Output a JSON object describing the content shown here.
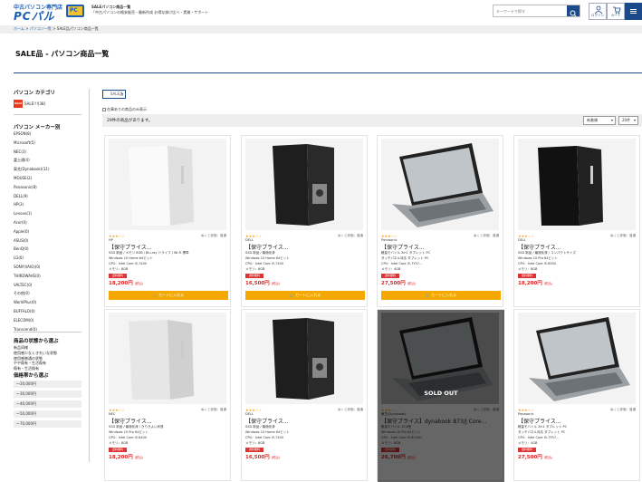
{
  "header": {
    "logo_small": "中古パソコン専門店",
    "logo_big": "PCパル",
    "logo_screen": "PC",
    "tagline1": "SALEパソコン商品一覧",
    "tagline2": "「中古パソコンの格安販売・最新作成 お得な掛け比べ・賃貸・サポート",
    "search_placeholder": "キーワードで探す",
    "login_label": "ログイン",
    "cart_label": "カート",
    "accent": "#1a4a8a"
  },
  "breadcrumb": {
    "home": "ホーム",
    "sep1": " > ",
    "list": "パソコン一覧",
    "sep2": " > ",
    "current": "SALE品パソコン商品一覧"
  },
  "page_title": "SALE品 - パソコン商品一覧",
  "sidebar": {
    "category_title": "パソコン カテゴリ",
    "category_item": "SALE!!!(38)",
    "sale_tag": "SALE",
    "maker_title": "パソコン メーカー別",
    "makers": [
      "EPSON(8)",
      "Microsoft(5)",
      "NEC(3)",
      "富士通(4)",
      "東芝(Dynabook)(11)",
      "MOUSE(2)",
      "Panasonic(8)",
      "DELL(9)",
      "HP(3)",
      "Lenovo(1)",
      "Acer(0)",
      "Apple(0)",
      "ASUS(0)",
      "BenQ(0)",
      "LG(0)",
      "SONY(VAIO)(0)",
      "THIRDWAVE(0)",
      "VALTEC(0)",
      "その他(0)",
      "WorldPlus(0)",
      "BUFFALO(0)",
      "ELECOM(0)",
      "Transcend(0)"
    ],
    "condition_title": "商品の状態から選ぶ",
    "conditions": [
      "新品同様",
      "使用感少なくきれいな状態",
      "使用感普通の状態",
      "やや傷有・生活傷有",
      "傷有・生活傷有"
    ],
    "price_title": "価格帯から選ぶ",
    "prices": [
      "〜20,000円",
      "〜30,000円",
      "〜40,000円",
      "〜50,000円",
      "〜70,000円"
    ]
  },
  "filter": {
    "sale_button": "SALE品",
    "checkbox_label": "在庫ありの商品のみ表示",
    "count_text": "29件の商品があります。",
    "sort_value": "新着順",
    "per_page_value": "20件"
  },
  "products": [
    {
      "stars": "★★★☆☆",
      "review": "ぬくと評価：普通",
      "maker": "HP",
      "name": "【保守プライス...",
      "d1": "SSD 新品 / メモリ 8GB / Blu-ray ドライブ / Wi-Fi 標準",
      "d2": "Windows 10 Home 64ビット",
      "d3": "CPU：Intel Core i5-7400",
      "d4": "メモリ：8GB",
      "badge": "送料無料",
      "price": "18,200円",
      "tax": "(税込)",
      "cart": "カートに入れる",
      "sold": false
    },
    {
      "stars": "★★★☆☆",
      "review": "ぬくと評価：普通",
      "maker": "DELL",
      "name": "【保守プライス...",
      "d1": "SSD 新品 / 最適化済",
      "d2": "Windows 10 Home 64ビット",
      "d3": "CPU：Intel Core i5-7400",
      "d4": "メモリ：8GB",
      "badge": "送料無料",
      "price": "16,500円",
      "tax": "(税込)",
      "cart": "カートに入れる",
      "sold": false
    },
    {
      "stars": "★★★☆☆",
      "review": "ぬくと評価：普通",
      "maker": "Panasonic",
      "name": "【保守プライス...",
      "d1": "軽量モバイル 2in1 タブレット PC",
      "d2": "タッチパネル対応 タブレット PC",
      "d3": "CPU：Intel Core i5-7Y57...",
      "d4": "メモリ：4GB",
      "badge": "送料無料",
      "price": "27,500円",
      "tax": "(税込)",
      "cart": "カートに入れる",
      "sold": false
    },
    {
      "stars": "★★★☆☆",
      "review": "ぬくと評価：普通",
      "maker": "DELL",
      "name": "【保守プライス...",
      "d1": "SSD 新品 / 最適化済 / コンパクトサイズ",
      "d2": "Windows 10 Pro 64ビット",
      "d3": "CPU：Intel Core i5-6500",
      "d4": "メモリ：8GB",
      "badge": "送料無料",
      "price": "18,200円",
      "tax": "(税込)",
      "cart": "",
      "sold": false
    },
    {
      "stars": "★★★☆☆",
      "review": "ぬくと評価：普通",
      "maker": "NEC",
      "name": "【保守プライス...",
      "d1": "SSD 新品 / 最適化済 / きりきよい状態",
      "d2": "Windows 10 Pro 64ビット",
      "d3": "CPU：Intel Core i5-6400",
      "d4": "メモリ：8GB",
      "badge": "送料無料",
      "price": "18,200円",
      "tax": "(税込)",
      "cart": "",
      "sold": false
    },
    {
      "stars": "★★★☆☆",
      "review": "ぬくと評価：普通",
      "maker": "DELL",
      "name": "【保守プライス...",
      "d1": "SSD 新品 / 最適化済",
      "d2": "Windows 10 Home 64ビット",
      "d3": "CPU：Intel Core i5-7400",
      "d4": "メモリ：8GB",
      "badge": "送料無料",
      "price": "16,500円",
      "tax": "(税込)",
      "cart": "",
      "sold": false
    },
    {
      "stars": "★★★☆☆",
      "review": "ぬくと評価：普通",
      "maker": "東芝(Dynabook)",
      "name": "【保守プライス】dynabook B73/J Core...",
      "d1": "軽量モバイル 15.6型",
      "d2": "Windows 10 Pro 64ビット",
      "d3": "CPU：Intel Core i5-8250U",
      "d4": "メモリ：8GB",
      "badge": "送料無料",
      "price": "26,700円",
      "tax": "(税込)",
      "cart": "",
      "sold": true,
      "sold_text": "SOLD OUT"
    },
    {
      "stars": "★★★☆☆",
      "review": "ぬくと評価：普通",
      "maker": "Panasonic",
      "name": "【保守プライス...",
      "d1": "軽量モバイル 2in1 タブレット PC",
      "d2": "タッチパネル対応 タブレット PC",
      "d3": "CPU：Intel Core i5-7Y57...",
      "d4": "メモリ：4GB",
      "badge": "送料無料",
      "price": "27,500円",
      "tax": "(税込)",
      "cart": "",
      "sold": false
    }
  ]
}
